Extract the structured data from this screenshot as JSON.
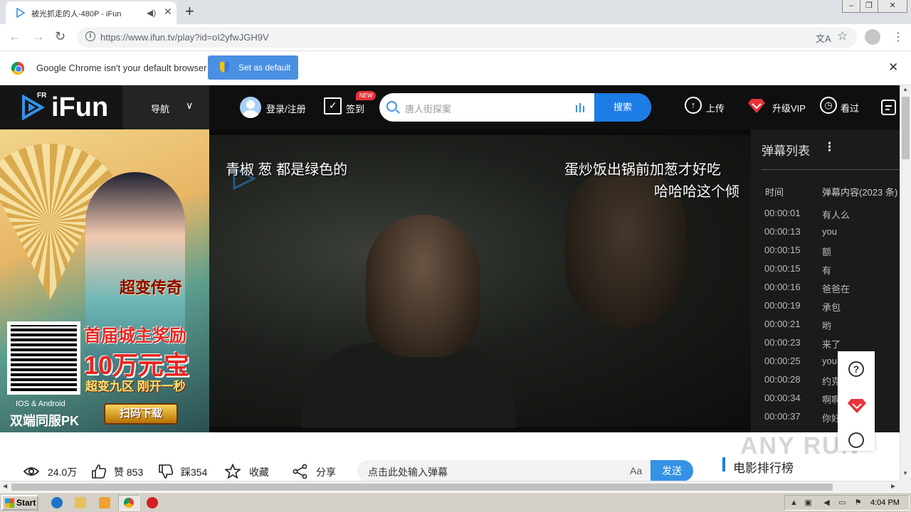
{
  "browser": {
    "tab_title": "被光抓走的人-480P - iFun",
    "url": "https://www.ifun.tv/play?id=oI2yfwJGH9V",
    "infobar_message": "Google Chrome isn't your default browser",
    "set_default_label": "Set as default"
  },
  "site": {
    "logo_text": "iFun",
    "logo_superscript": "FR",
    "nav_label": "导航",
    "login_label": "登录/注册",
    "checkin_label": "签到",
    "new_badge": "NEW",
    "search_placeholder": "唐人街探案",
    "search_button": "搜索",
    "upload_label": "上传",
    "vip_label": "升级VIP",
    "history_label": "看过"
  },
  "ad": {
    "game_title": "超变传奇",
    "promo_line1": "首届城主奖励",
    "promo_line2": "10万元宝",
    "promo_line3": "超变九区 刚开一秒",
    "platforms": "IOS & Android",
    "slogan": "双端同服PK",
    "download_button": "扫码下载"
  },
  "player": {
    "danmu": [
      "青椒 葱 都是绿色的",
      "蛋炒饭出锅前加葱才好吃",
      "哈哈哈这个倾"
    ]
  },
  "danmaku_panel": {
    "title": "弹幕列表",
    "col_time": "时间",
    "col_content": "弹幕内容(2023 条)",
    "rows": [
      {
        "time": "00:00:01",
        "content": "有人么"
      },
      {
        "time": "00:00:13",
        "content": "you"
      },
      {
        "time": "00:00:15",
        "content": "额"
      },
      {
        "time": "00:00:15",
        "content": "有"
      },
      {
        "time": "00:00:16",
        "content": "爸爸在"
      },
      {
        "time": "00:00:19",
        "content": "承包"
      },
      {
        "time": "00:00:21",
        "content": "哟"
      },
      {
        "time": "00:00:23",
        "content": "来了"
      },
      {
        "time": "00:00:25",
        "content": "you"
      },
      {
        "time": "00:00:28",
        "content": "约克"
      },
      {
        "time": "00:00:34",
        "content": "啊啊"
      },
      {
        "time": "00:00:37",
        "content": "你好"
      }
    ]
  },
  "stats": {
    "views": "24.0万",
    "likes": "赞 853",
    "dislikes": "踩354",
    "favorite": "收藏",
    "share": "分享"
  },
  "danmu_input": {
    "placeholder": "点击此处输入弹幕",
    "font_toggle": "Aa",
    "send_button": "发送"
  },
  "ranking_title": "电影排行榜",
  "watermark": "ANY RUN",
  "taskbar": {
    "start_label": "Start",
    "clock": "4:04 PM"
  },
  "colors": {
    "accent_blue": "#1d7ce6",
    "header_bg": "#0f0f0f",
    "vip_red": "#e8333a"
  }
}
